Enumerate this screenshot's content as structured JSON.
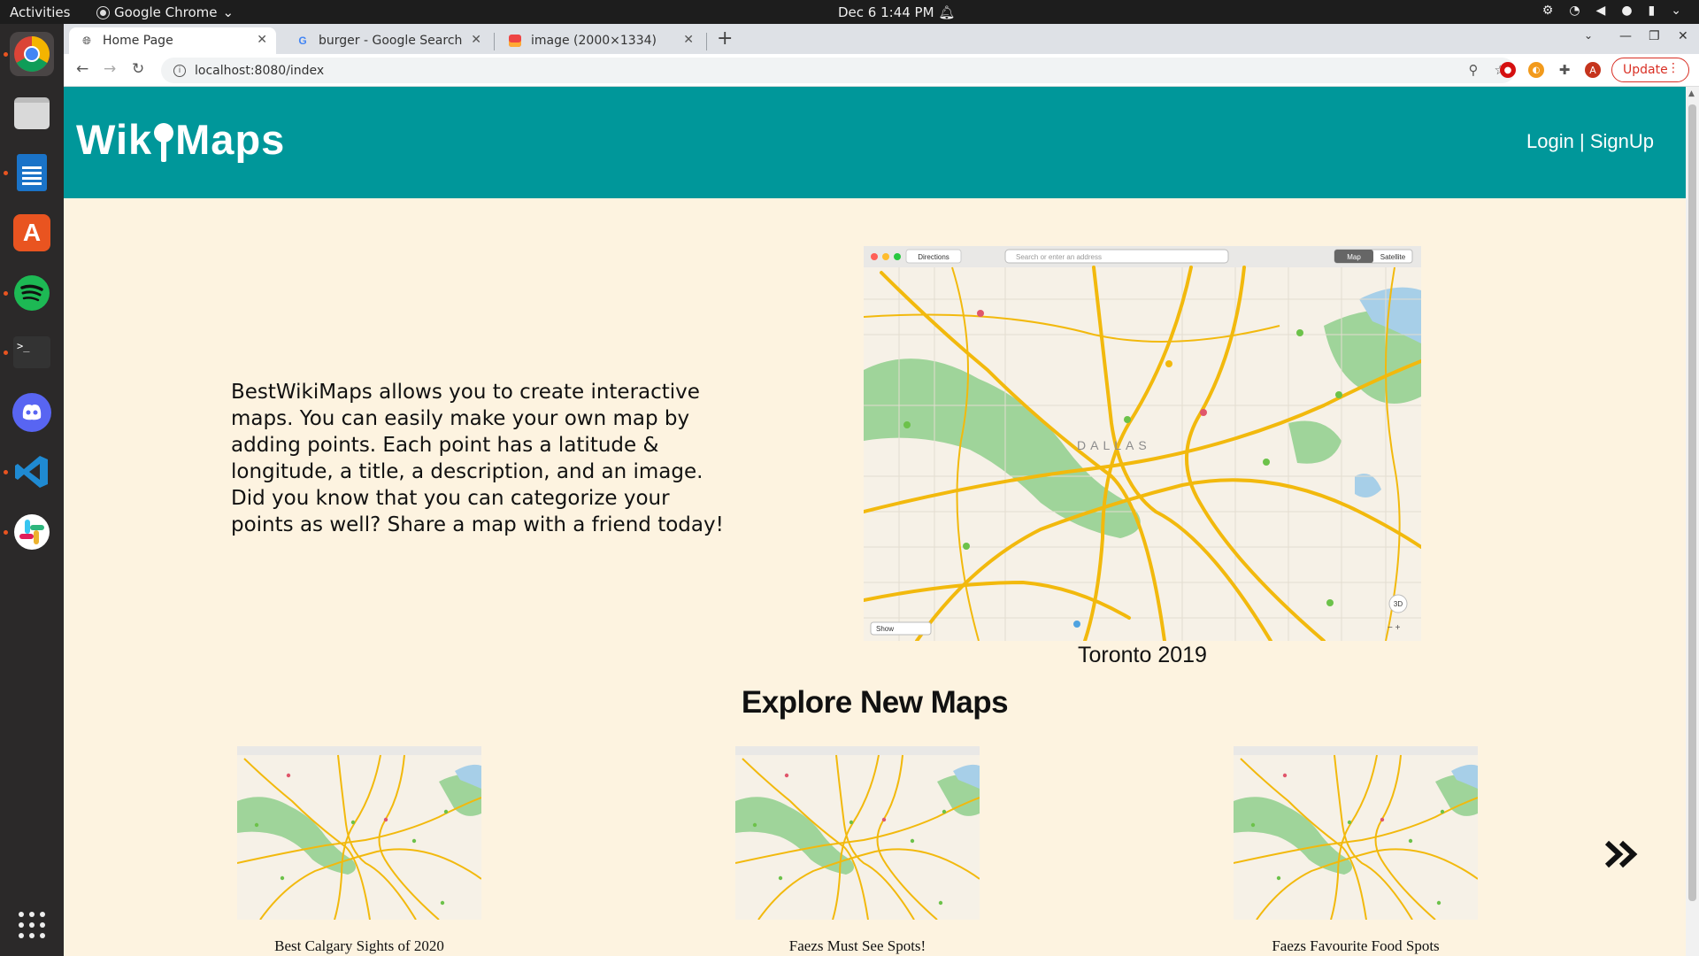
{
  "os": {
    "activities": "Activities",
    "app_name": "Google Chrome",
    "clock": "Dec 6  1:44 PM"
  },
  "browser": {
    "tabs": [
      {
        "title": "Home Page",
        "icon": "globe-icon"
      },
      {
        "title": "burger - Google Search",
        "icon": "google-icon"
      },
      {
        "title": "image (2000×1334)",
        "icon": "image-icon"
      }
    ],
    "url": "localhost:8080/index",
    "update_label": "Update",
    "profile_initial": "A"
  },
  "site": {
    "logo_left": "Wik",
    "logo_right": "Maps",
    "login_label": "Login",
    "separator": " | ",
    "signup_label": "SignUp",
    "intro": "BestWikiMaps allows you to create interactive maps. You can easily make your own map by adding points. Each point has a latitude & longitude, a title, a description, and an image. Did you know that you can categorize your points as well? Share a map with a friend today!",
    "featured": {
      "caption": "Toronto 2019",
      "map_city_label": "DALLAS",
      "toolbar_directions": "Directions",
      "search_placeholder": "Search or enter an address",
      "map_btn": "Map",
      "satellite_btn": "Satellite",
      "show_label": "Show",
      "btn_3d": "3D"
    },
    "explore_heading": "Explore New Maps",
    "cards": [
      {
        "title": "Best Calgary Sights of 2020"
      },
      {
        "title": "Faezs Must See Spots!"
      },
      {
        "title": "Faezs Favourite Food Spots"
      }
    ]
  },
  "colors": {
    "header": "#00979a",
    "page_bg": "#fdf3e0",
    "road_major": "#f2b90d",
    "park": "#9fd49a",
    "water": "#a7cfe8"
  }
}
